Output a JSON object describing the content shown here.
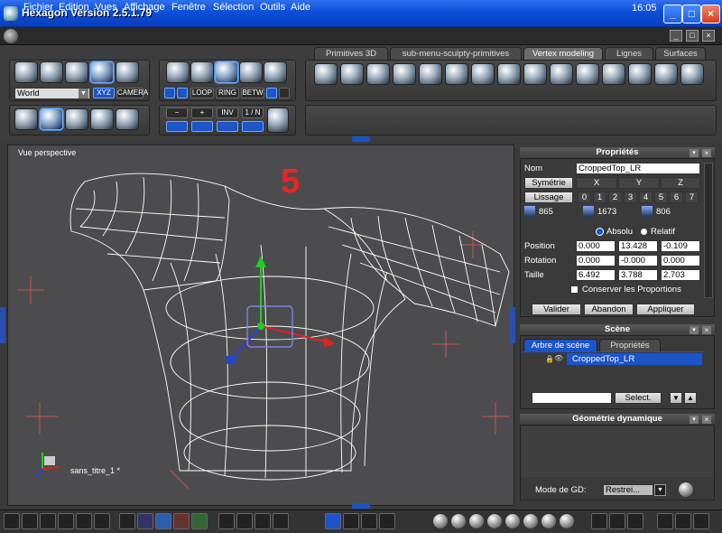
{
  "window": {
    "title": "Hexagon Version 2.5.1.79",
    "min_label": "_",
    "max_label": "□",
    "close_label": "×"
  },
  "menubar": {
    "items": [
      "Fichier",
      "Edition",
      "Vues",
      "Affichage",
      "Fenêtre",
      "Sélection",
      "Outils",
      "Aide"
    ],
    "clock": "16:05",
    "min_label": "_",
    "restore_label": "□",
    "close_label": "×"
  },
  "tabs": [
    "Primitives 3D",
    "sub-menu-sculpty-primitives",
    "Vertex modeling",
    "Lignes",
    "Surfaces"
  ],
  "toolbar": {
    "coord_select": "World",
    "xyz_label": "XYZ",
    "camera_label": "CAMERA",
    "loop_label": "LOOP",
    "ring_label": "RING",
    "betw_label": "BETW",
    "minus_label": "−",
    "plus_label": "+",
    "inv_label": "INV",
    "in_label": "1 / N"
  },
  "viewport": {
    "label": "Vue perspective",
    "overlay_number": "5",
    "file_label": "sans_titre_1 *"
  },
  "properties": {
    "title": "Propriétés",
    "name_label": "Nom",
    "name_value": "CroppedTop_LR",
    "symmetry_label": "Symétrie",
    "axes": [
      "X",
      "Y",
      "Z"
    ],
    "smoothing_label": "Lissage",
    "levels": [
      "0",
      "1",
      "2",
      "3",
      "4",
      "5",
      "6",
      "7"
    ],
    "stats": [
      "865",
      "1673",
      "806"
    ],
    "absolute_label": "Absolu",
    "relative_label": "Relatif",
    "rows": [
      {
        "label": "Position",
        "values": [
          "0.000",
          "13.428",
          "-0.109"
        ]
      },
      {
        "label": "Rotation",
        "values": [
          "0.000",
          "-0.000",
          "0.000"
        ]
      },
      {
        "label": "Taille",
        "values": [
          "6.492",
          "3.788",
          "2.703"
        ]
      }
    ],
    "keep_proportions": "Conserver les Proportions",
    "validate": "Valider",
    "cancel": "Abandon",
    "apply": "Appliquer"
  },
  "scene": {
    "title": "Scène",
    "tabs": [
      "Arbre de scène",
      "Propriétés"
    ],
    "item": "CroppedTop_LR",
    "select_label": "Select.",
    "down_arrow": "▼",
    "up_arrow": "▲"
  },
  "dyn_geo": {
    "title": "Géométrie dynamique",
    "mode_label": "Mode de GD:",
    "mode_value": "Restrei..."
  }
}
